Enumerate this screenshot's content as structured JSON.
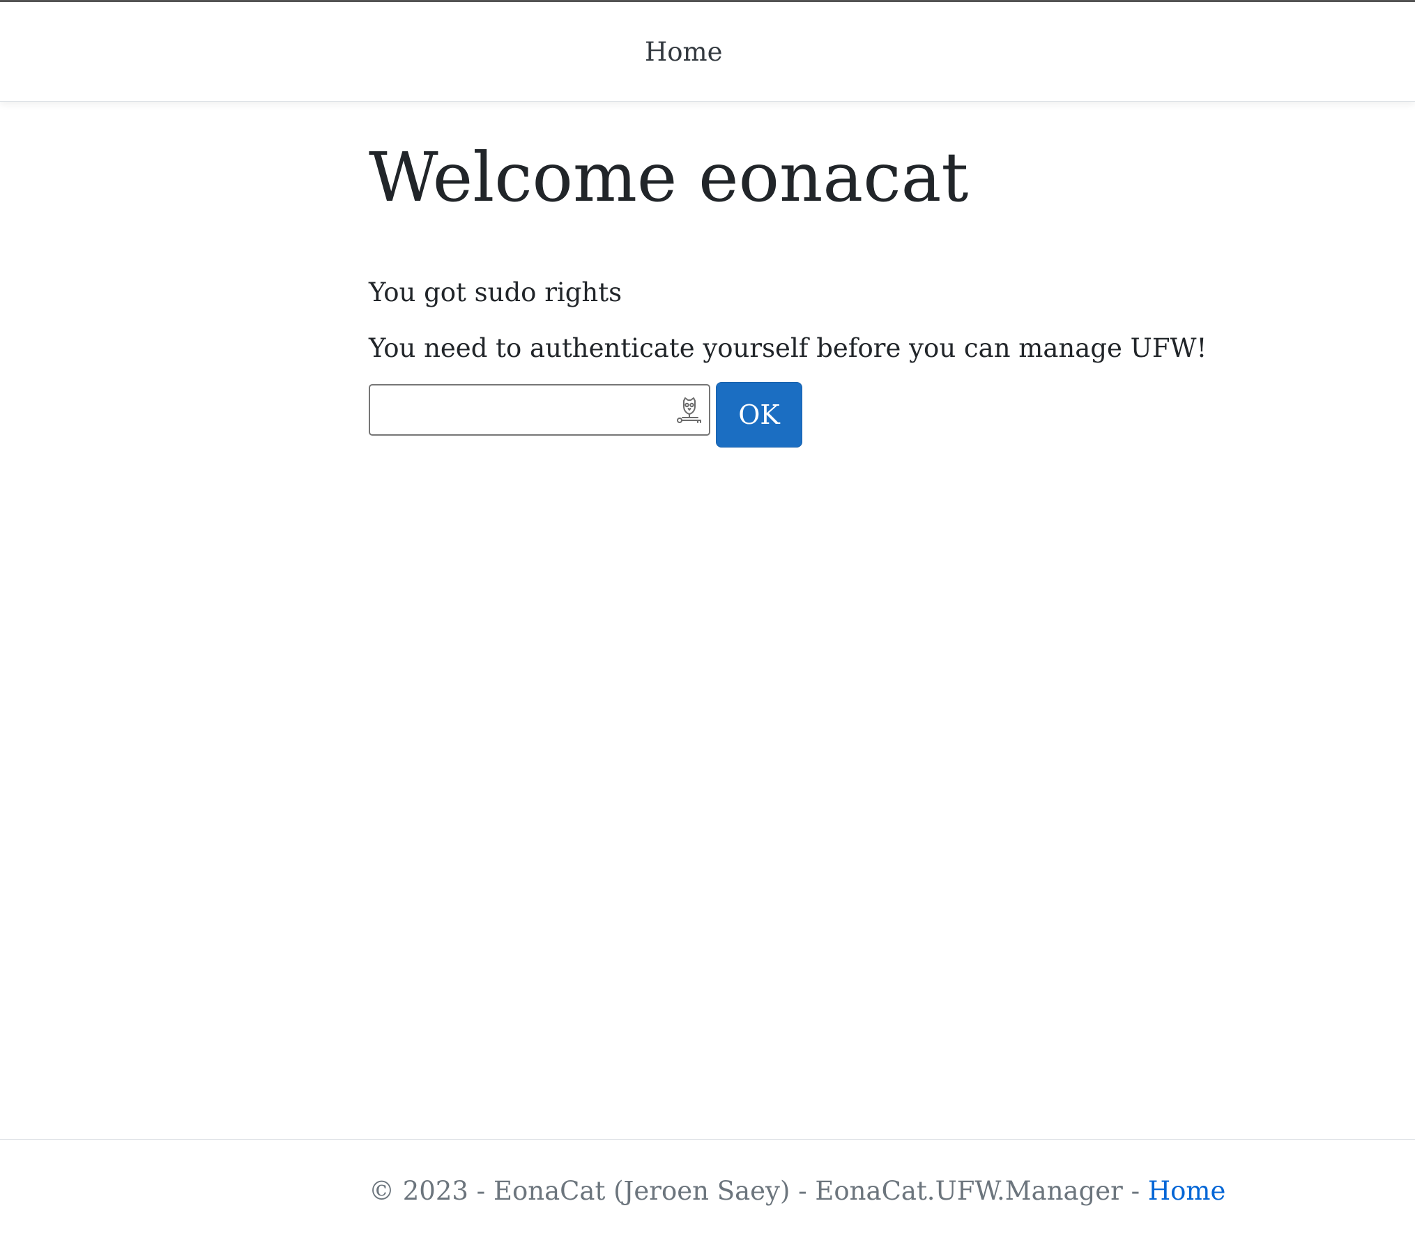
{
  "nav": {
    "home_label": "Home"
  },
  "main": {
    "title": "Welcome eonacat",
    "sudo_message": "You got sudo rights",
    "auth_message": "You need to authenticate yourself before you can manage UFW!",
    "password_field": {
      "value": "",
      "placeholder": "",
      "icon": "password-manager-icon"
    },
    "ok_label": "OK"
  },
  "footer": {
    "copyright_text": "© 2023 - EonaCat (Jeroen Saey) - EonaCat.UFW.Manager - ",
    "home_link": "Home"
  },
  "colors": {
    "primary_button": "#1b6ec2",
    "link": "#0366d6",
    "footer_text": "#6c757d",
    "text": "#212529"
  }
}
